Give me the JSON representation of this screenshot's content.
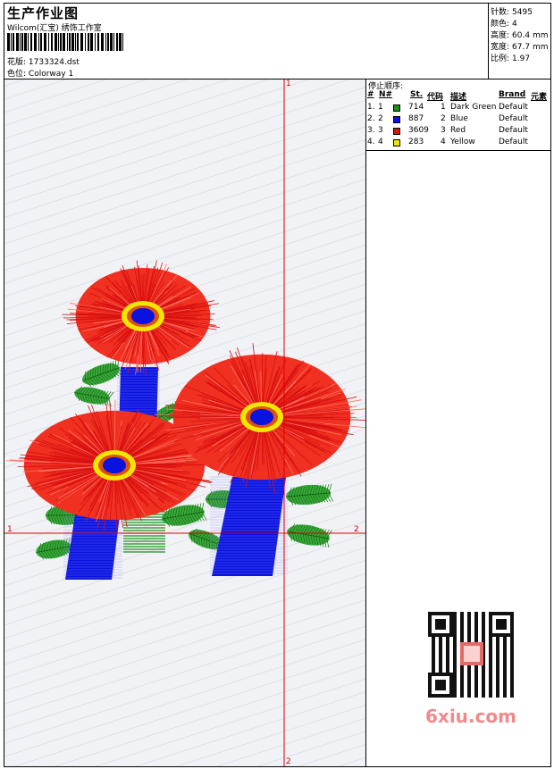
{
  "header": {
    "title": "生产作业图",
    "subtitle": "Wilcom(汇宝) 绣饰工作室",
    "design_label": "花版:",
    "design_value": "1733324.dst",
    "colorway_label": "色位:",
    "colorway_value": "Colorway 1"
  },
  "stats": [
    {
      "label": "针数:",
      "value": "5495"
    },
    {
      "label": "颜色:",
      "value": "4"
    },
    {
      "label": "高度:",
      "value": "60.4 mm"
    },
    {
      "label": "宽度:",
      "value": "67.7 mm"
    },
    {
      "label": "比例:",
      "value": "1.97"
    }
  ],
  "stop_sequence": {
    "title": "停止顺序:",
    "columns": [
      "#",
      "N#",
      "St.",
      "代码",
      "描述",
      "Brand",
      "元素"
    ],
    "rows": [
      {
        "idx": "1.",
        "n": "1",
        "color": "#1a8f1a",
        "st": "714",
        "code": "1",
        "desc": "Dark Green",
        "brand": "Default"
      },
      {
        "idx": "2.",
        "n": "2",
        "color": "#0a12e0",
        "st": "887",
        "code": "2",
        "desc": "Blue",
        "brand": "Default"
      },
      {
        "idx": "3.",
        "n": "3",
        "color": "#e01010",
        "st": "3609",
        "code": "3",
        "desc": "Red",
        "brand": "Default"
      },
      {
        "idx": "4.",
        "n": "4",
        "color": "#f2e600",
        "st": "283",
        "code": "4",
        "desc": "Yellow",
        "brand": "Default"
      }
    ]
  },
  "axes": {
    "top_label": "1",
    "bottom_label": "2",
    "left_label": "1",
    "right_label": "2"
  },
  "watermark": {
    "text": "6xiu.com"
  },
  "colors": {
    "axis": "#e00000",
    "green": "#1a8f1a",
    "blue": "#0a12e0",
    "red": "#e01010",
    "yellow": "#f2e600"
  }
}
